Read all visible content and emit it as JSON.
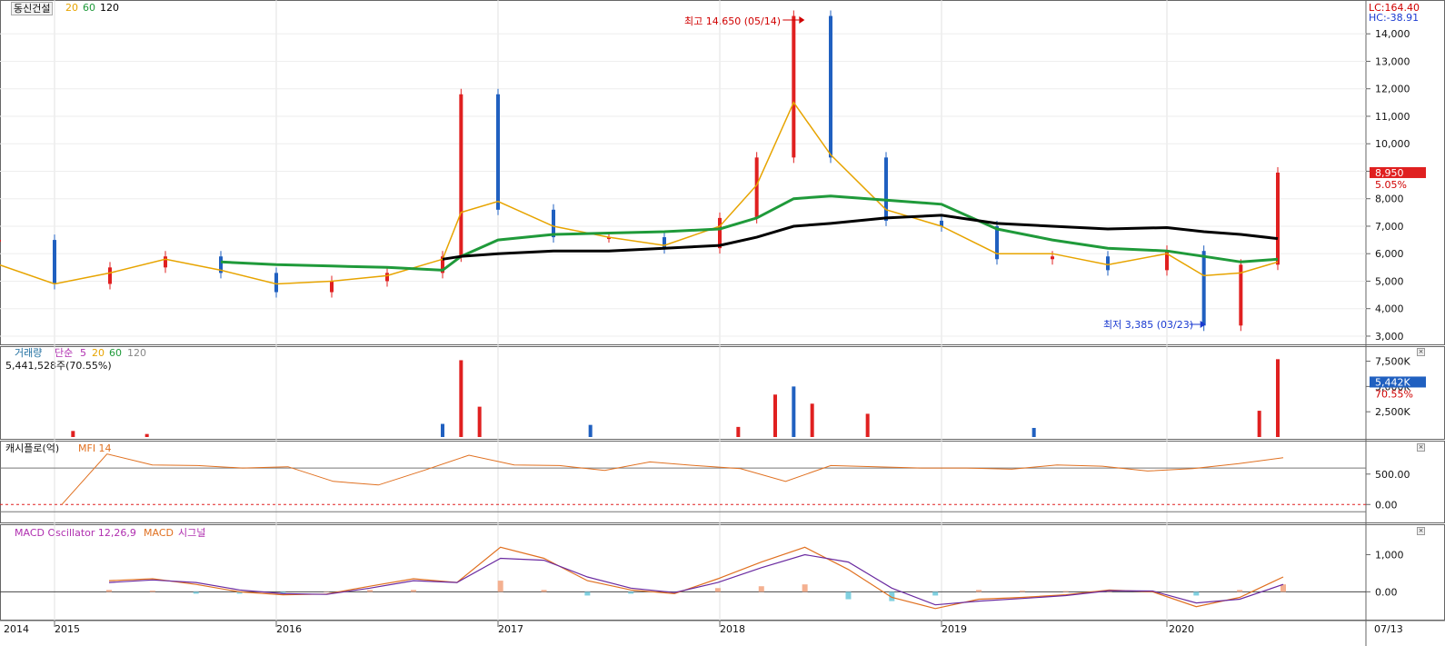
{
  "header": {
    "stock_name": "동신건설",
    "ma_periods": [
      "20",
      "60",
      "120"
    ],
    "ma_colors": [
      "#e7a400",
      "#1f9a3a",
      "#000000"
    ],
    "lc_label": "LC:164.40",
    "hc_label": "HC:-38.91"
  },
  "price_panel": {
    "high_annotation": "최고 14,650 (05/14)",
    "low_annotation": "최저 3,385 (03/23)",
    "current_price": "8,950",
    "change_pct": "5.05%",
    "y_ticks": [
      "14,000",
      "13,000",
      "12,000",
      "11,000",
      "10,000",
      "9,000",
      "8,000",
      "7,000",
      "6,000",
      "5,000",
      "4,000",
      "3,000"
    ]
  },
  "volume_panel": {
    "title_parts": [
      "거래량",
      "단순",
      "5",
      "20",
      "60",
      "120"
    ],
    "value_label": "5,441,528주(70.55%)",
    "current_volume": "5,442K",
    "current_pct": "70.55%",
    "y_ticks": [
      "7,500K",
      "5,000K",
      "2,500K"
    ]
  },
  "mfi_panel": {
    "title_parts": [
      "캐시플로(억)",
      "MFI 14"
    ],
    "y_ticks": [
      "500.00",
      "0.00"
    ]
  },
  "macd_panel": {
    "title_parts": [
      "MACD Oscillator 12,26,9",
      "MACD",
      "시그널"
    ],
    "y_ticks": [
      "1,000",
      "0.00"
    ]
  },
  "x_axis": {
    "labels": [
      "2014",
      "2015",
      "2016",
      "2017",
      "2018",
      "2019",
      "2020",
      "07/13"
    ]
  },
  "chart_data": [
    {
      "type": "line",
      "title": "동신건설",
      "x": [
        "2014-10",
        "2015-01",
        "2015-04",
        "2015-07",
        "2015-10",
        "2016-01",
        "2016-04",
        "2016-07",
        "2016-10",
        "2016-11",
        "2017-01",
        "2017-04",
        "2017-07",
        "2017-10",
        "2018-01",
        "2018-03",
        "2018-05",
        "2018-07",
        "2018-10",
        "2019-01",
        "2019-04",
        "2019-07",
        "2019-10",
        "2020-01",
        "2020-03",
        "2020-05",
        "2020-07"
      ],
      "series": [
        {
          "name": "price",
          "values": [
            6500,
            4900,
            5500,
            5900,
            5300,
            4600,
            5000,
            5300,
            5900,
            11800,
            7600,
            6600,
            6600,
            6200,
            7300,
            9500,
            14650,
            9500,
            7200,
            7000,
            5800,
            5900,
            5400,
            6100,
            3385,
            5600,
            8950
          ]
        },
        {
          "name": "20",
          "values": [
            5600,
            4900,
            5300,
            5800,
            5400,
            4900,
            5000,
            5200,
            5800,
            7500,
            7900,
            7000,
            6600,
            6300,
            7000,
            8500,
            11500,
            9600,
            7600,
            7000,
            6000,
            6000,
            5600,
            6000,
            5200,
            5300,
            5700
          ]
        },
        {
          "name": "60",
          "values": [
            null,
            null,
            null,
            null,
            5700,
            5600,
            5550,
            5500,
            5400,
            5900,
            6500,
            6700,
            6750,
            6800,
            6900,
            7300,
            8000,
            8100,
            7950,
            7800,
            6900,
            6500,
            6200,
            6100,
            5900,
            5700,
            5800
          ]
        },
        {
          "name": "120",
          "values": [
            null,
            null,
            null,
            null,
            null,
            null,
            null,
            null,
            5800,
            5900,
            6000,
            6100,
            6100,
            6200,
            6300,
            6600,
            7000,
            7100,
            7300,
            7400,
            7100,
            7000,
            6900,
            6950,
            6800,
            6700,
            6550
          ]
        }
      ],
      "ylim": [
        2800,
        14900
      ]
    },
    {
      "type": "bar",
      "title": "거래량",
      "x": [
        "2015-02",
        "2015-06",
        "2016-10",
        "2016-11",
        "2016-12",
        "2017-06",
        "2018-02",
        "2018-04",
        "2018-05",
        "2018-06",
        "2018-09",
        "2019-06",
        "2020-06",
        "2020-07"
      ],
      "values": [
        600,
        300,
        1300,
        7600,
        3000,
        1200,
        1000,
        4200,
        5000,
        3300,
        2300,
        900,
        2600,
        7700
      ],
      "ylim": [
        0,
        8000
      ]
    },
    {
      "type": "line",
      "title": "MFI 14",
      "series": [
        {
          "name": "MFI 14",
          "values": [
            0,
            830,
            650,
            640,
            600,
            620,
            380,
            320,
            560,
            810,
            650,
            640,
            560,
            700,
            640,
            590,
            380,
            640,
            620,
            600,
            600,
            580,
            650,
            630,
            550,
            590,
            670,
            770
          ]
        }
      ],
      "ylim": [
        -250,
        900
      ]
    },
    {
      "type": "line",
      "title": "MACD Oscillator 12,26,9",
      "series": [
        {
          "name": "MACD",
          "values": [
            300,
            350,
            200,
            0,
            -80,
            -60,
            150,
            350,
            250,
            1200,
            900,
            300,
            50,
            -50,
            350,
            800,
            1200,
            600,
            -150,
            -450,
            -200,
            -150,
            -80,
            50,
            0,
            -400,
            -150,
            400
          ]
        },
        {
          "name": "시그널",
          "values": [
            250,
            320,
            250,
            50,
            -50,
            -70,
            100,
            300,
            250,
            900,
            850,
            400,
            100,
            -20,
            250,
            650,
            1000,
            800,
            100,
            -350,
            -250,
            -180,
            -100,
            30,
            20,
            -300,
            -200,
            200
          ]
        }
      ],
      "ylim": [
        -700,
        1500
      ]
    }
  ]
}
